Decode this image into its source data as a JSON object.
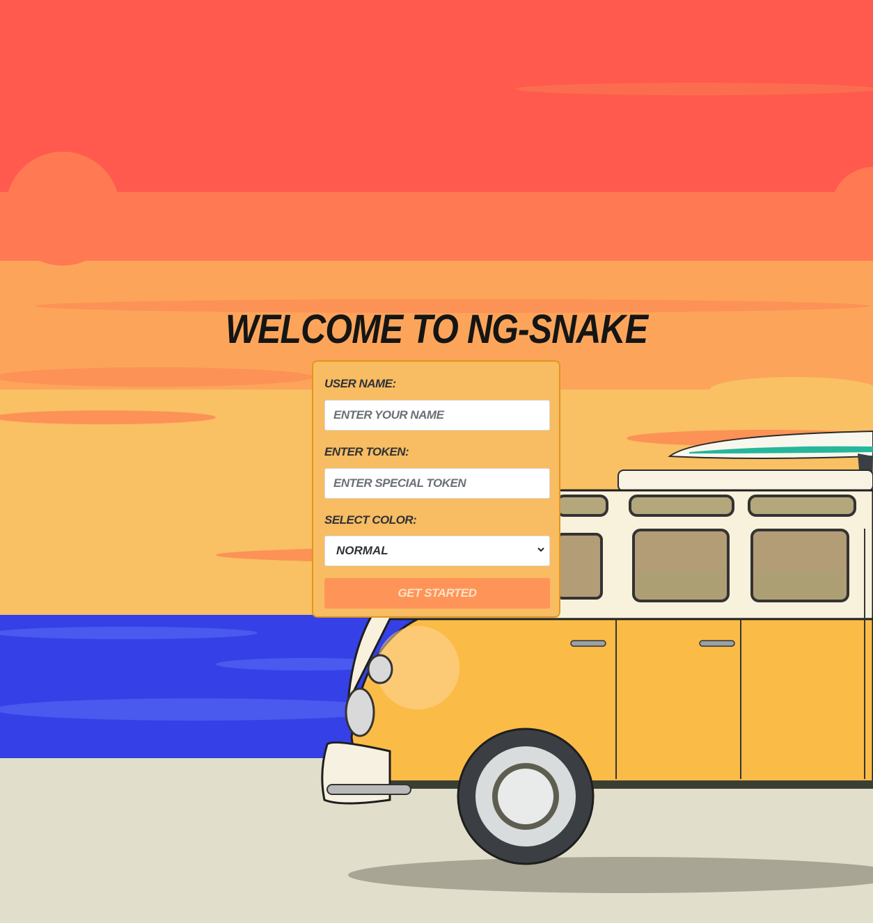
{
  "page": {
    "title": "Welcome to ng-snake"
  },
  "form": {
    "username_label": "User Name:",
    "username_placeholder": "Enter your name",
    "token_label": "Enter Token:",
    "token_placeholder": "Enter special token",
    "color_label": "Select Color:",
    "color_selected": "Normal",
    "submit_label": "Get Started"
  },
  "colors": {
    "sky_top": "#ff5a4d",
    "sky_mid": "#ff7a52",
    "sky_low": "#fca55a",
    "sky_horizon": "#f9c064",
    "sea": "#3540e6",
    "sand": "#e1dfcb",
    "card_bg": "#f8bc62",
    "button_bg": "#ff9458",
    "van_body": "#fbbb47"
  },
  "icons": {
    "select_arrow": "chevron-down-icon"
  }
}
